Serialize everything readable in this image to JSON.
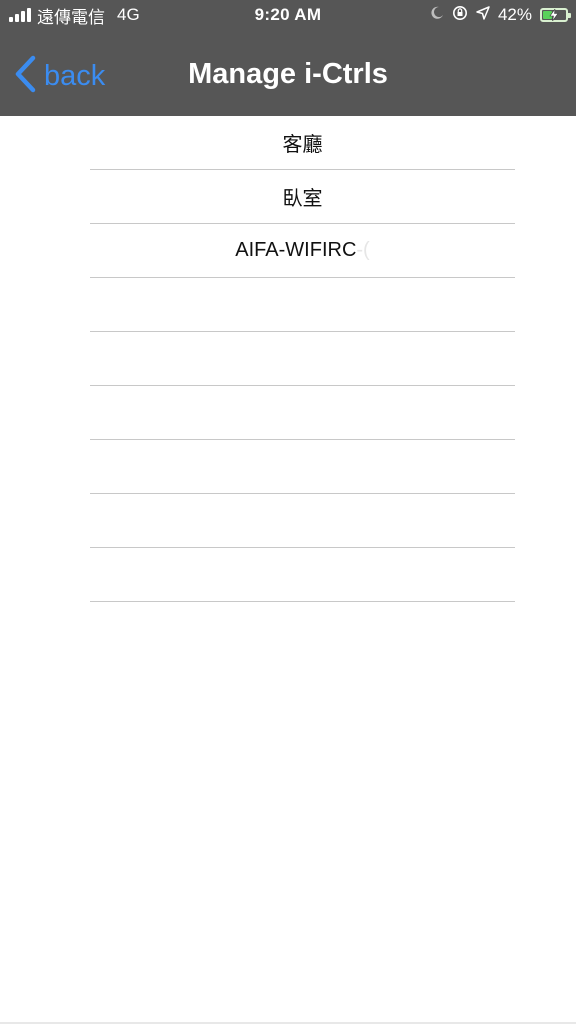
{
  "status_bar": {
    "carrier": "遠傳電信",
    "network": "4G",
    "time": "9:20 AM",
    "battery_percent": "42%",
    "battery_level": 0.42,
    "icons": [
      "signal-bars-icon",
      "moon-icon",
      "orientation-lock-icon",
      "location-arrow-icon",
      "battery-charging-icon"
    ]
  },
  "navbar": {
    "back_label": "back",
    "title": "Manage i-Ctrls",
    "back_color": "#3b8cf0",
    "background": "#565656"
  },
  "devices": [
    {
      "label": "客廳",
      "suffix": ""
    },
    {
      "label": "臥室",
      "suffix": ""
    },
    {
      "label": "AIFA-WIFIRC",
      "suffix": "-("
    },
    {
      "label": "",
      "suffix": ""
    },
    {
      "label": "",
      "suffix": ""
    },
    {
      "label": "",
      "suffix": ""
    },
    {
      "label": "",
      "suffix": ""
    },
    {
      "label": "",
      "suffix": ""
    },
    {
      "label": "",
      "suffix": ""
    }
  ]
}
